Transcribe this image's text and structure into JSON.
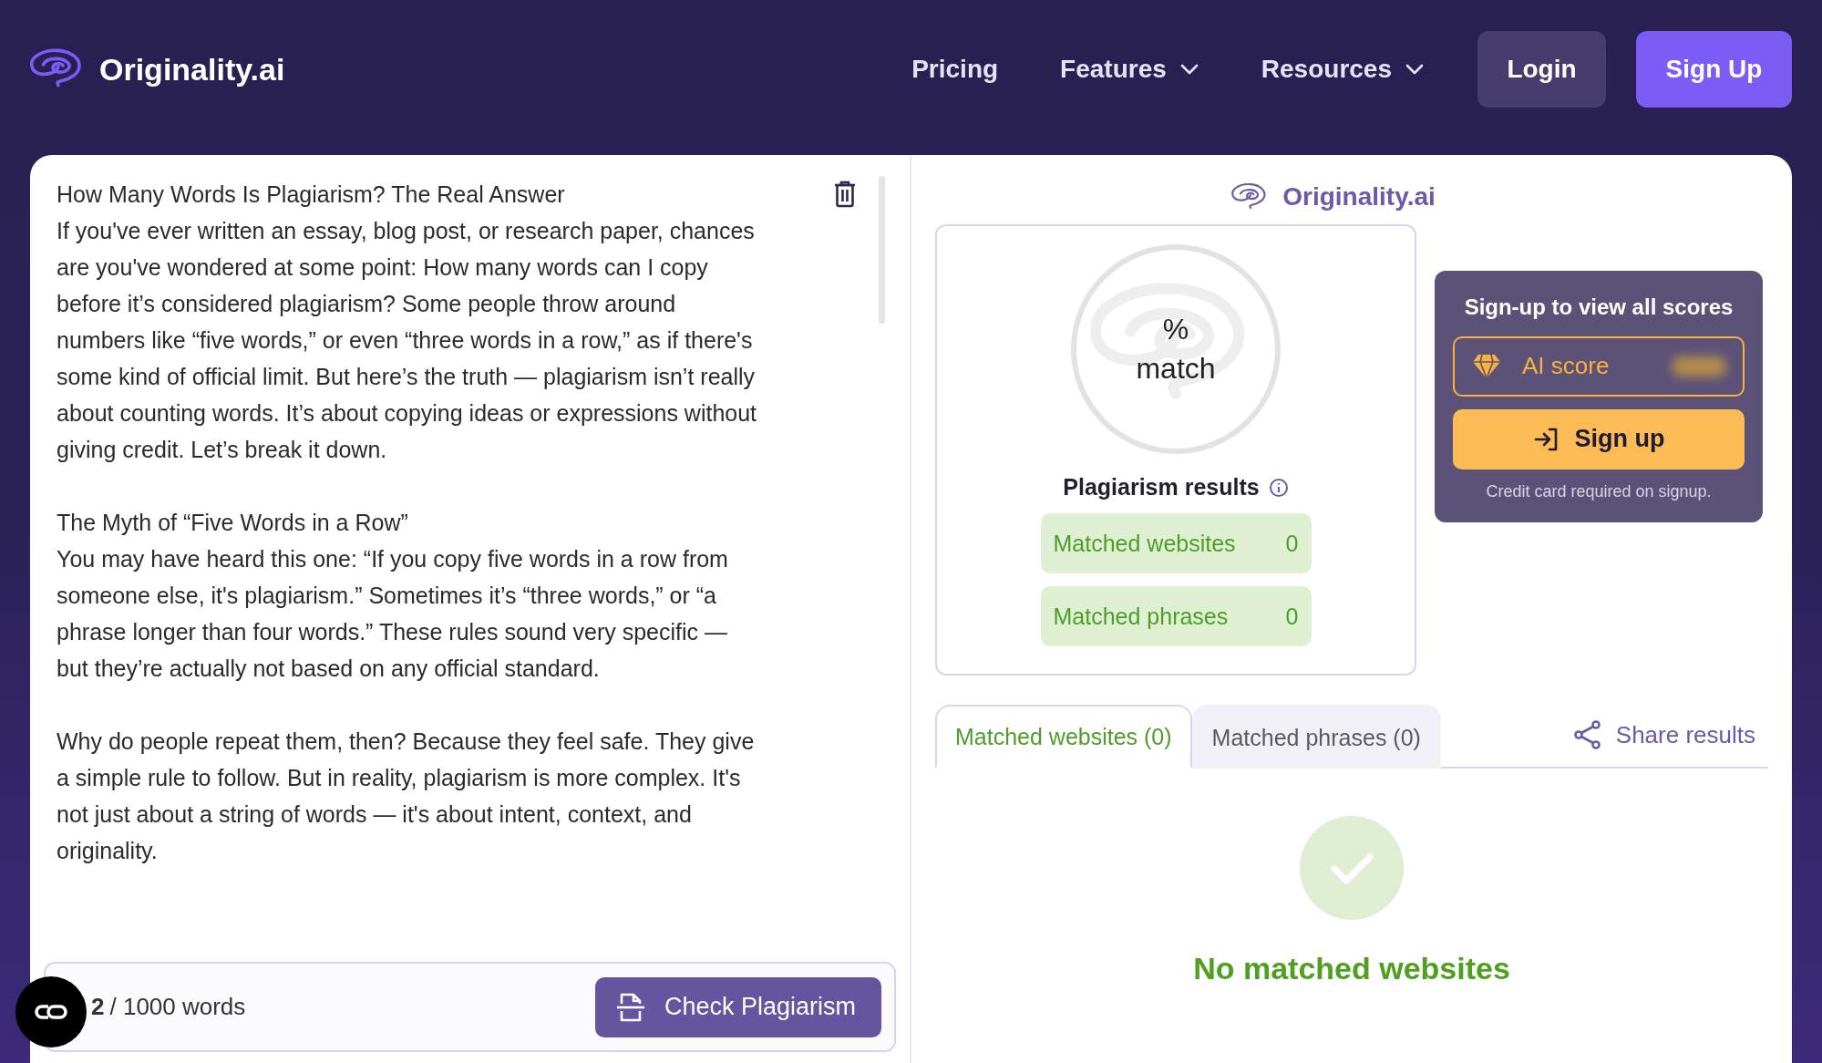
{
  "header": {
    "logo": "Originality.ai",
    "nav": [
      {
        "label": "Pricing",
        "dropdown": false
      },
      {
        "label": "Features",
        "dropdown": true
      },
      {
        "label": "Resources",
        "dropdown": true
      }
    ],
    "buttons": [
      {
        "label": "Login",
        "kind": "secondary"
      },
      {
        "label": "Sign Up",
        "kind": "primary"
      }
    ]
  },
  "editor": {
    "sections": [
      [
        "How Many Words Is Plagiarism? The Real Answer",
        "If you've ever written an essay, blog post, or research paper, chances are you've wondered at some point: How many words can I copy before it’s considered plagiarism? Some people throw around numbers like “five words,” or even “three words in a row,” as if there's some kind of official limit. But here’s the truth — plagiarism isn’t really about counting words. It’s about copying ideas or expressions without giving credit. Let’s break it down."
      ],
      [
        "The Myth of “Five Words in a Row”",
        "You may have heard this one: “If you copy five words in a row from someone else, it's plagiarism.” Sometimes it’s “three words,” or “a phrase longer than four words.” These rules sound very specific — but they’re actually not based on any official standard."
      ],
      [
        "Why do people repeat them, then? Because they feel safe. They give a simple rule to follow. But in reality, plagiarism is more complex. It's not just about a string of words — it's about intent, context, and originality."
      ]
    ],
    "word_count": "2",
    "word_limit": "/ 1000 words",
    "check_button": "Check Plagiarism"
  },
  "results": {
    "brand": "Originality.ai",
    "gauge_symbol": "%",
    "gauge_label": "match",
    "title": "Plagiarism results",
    "stats": [
      {
        "label": "Matched websites",
        "value": "0"
      },
      {
        "label": "Matched phrases",
        "value": "0"
      }
    ],
    "signup": {
      "title": "Sign-up to view all scores",
      "score_label": "AI score",
      "button": "Sign up",
      "note": "Credit card required on signup."
    },
    "tabs": [
      {
        "label": "Matched websites (0)",
        "selected": true
      },
      {
        "label": "Matched phrases (0)",
        "selected": false
      }
    ],
    "share": "Share results",
    "empty_message": "No matched websites"
  }
}
